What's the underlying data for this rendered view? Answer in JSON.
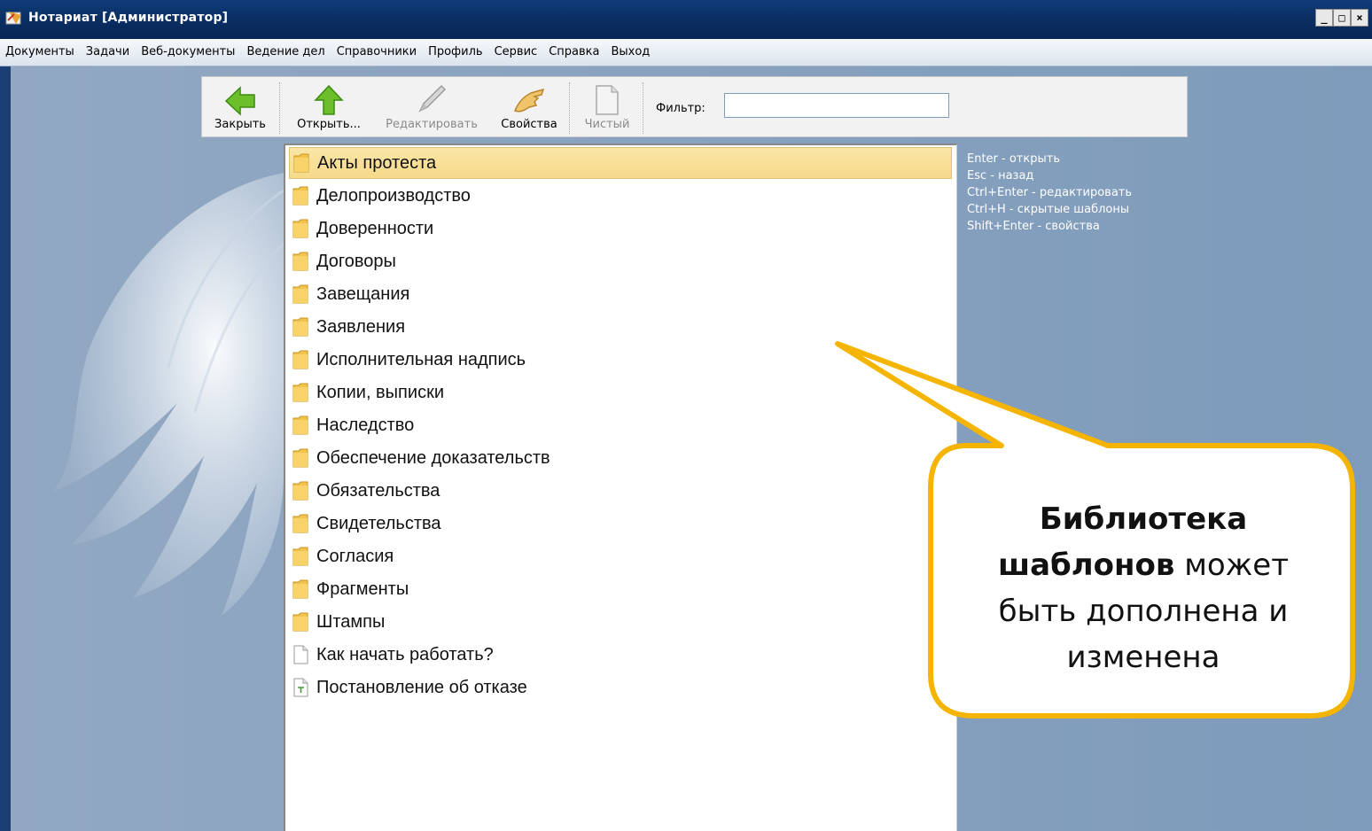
{
  "window": {
    "title": "Нотариат [Администратор]",
    "controls": {
      "minimize": "_",
      "maximize": "□",
      "close": "×"
    }
  },
  "menu": {
    "items": [
      "Документы",
      "Задачи",
      "Веб-документы",
      "Ведение дел",
      "Справочники",
      "Профиль",
      "Сервис",
      "Справка",
      "Выход"
    ]
  },
  "toolbar": {
    "buttons": [
      {
        "label": "Закрыть",
        "icon": "arrow-left-icon",
        "enabled": true
      },
      {
        "label": "Открыть...",
        "icon": "arrow-up-icon",
        "enabled": true
      },
      {
        "label": "Редактировать",
        "icon": "pencil-icon",
        "enabled": false
      },
      {
        "label": "Свойства",
        "icon": "hand-icon",
        "enabled": true
      },
      {
        "label": "Чистый",
        "icon": "blank-page-icon",
        "enabled": false
      }
    ],
    "filter_label": "Фильтр:",
    "filter_value": ""
  },
  "list": {
    "items": [
      {
        "label": "Акты протеста",
        "type": "folder",
        "selected": true
      },
      {
        "label": "Делопроизводство",
        "type": "folder"
      },
      {
        "label": "Доверенности",
        "type": "folder"
      },
      {
        "label": "Договоры",
        "type": "folder"
      },
      {
        "label": "Завещания",
        "type": "folder"
      },
      {
        "label": "Заявления",
        "type": "folder"
      },
      {
        "label": "Исполнительная надпись",
        "type": "folder"
      },
      {
        "label": "Копии, выписки",
        "type": "folder"
      },
      {
        "label": "Наследство",
        "type": "folder"
      },
      {
        "label": "Обеспечение доказательств",
        "type": "folder"
      },
      {
        "label": "Обязательства",
        "type": "folder"
      },
      {
        "label": "Свидетельства",
        "type": "folder"
      },
      {
        "label": "Согласия",
        "type": "folder"
      },
      {
        "label": "Фрагменты",
        "type": "folder"
      },
      {
        "label": "Штампы",
        "type": "folder"
      },
      {
        "label": "Как начать работать?",
        "type": "document"
      },
      {
        "label": "Постановление об отказе",
        "type": "template"
      }
    ]
  },
  "hints": [
    "Enter - открыть",
    "Esc - назад",
    "Ctrl+Enter - редактировать",
    "Ctrl+H - скрытые шаблоны",
    "Shift+Enter - свойства"
  ],
  "callout": {
    "bold_line1": "Библиотека",
    "bold_word2": "шаблонов",
    "rest_line2": " может",
    "line3": "быть дополнена и",
    "line4": "изменена"
  },
  "colors": {
    "titlebar": "#0a2d62",
    "workspace": "#8aa3c0",
    "selected_row": "#f6d98a",
    "callout_border": "#f4b400"
  }
}
